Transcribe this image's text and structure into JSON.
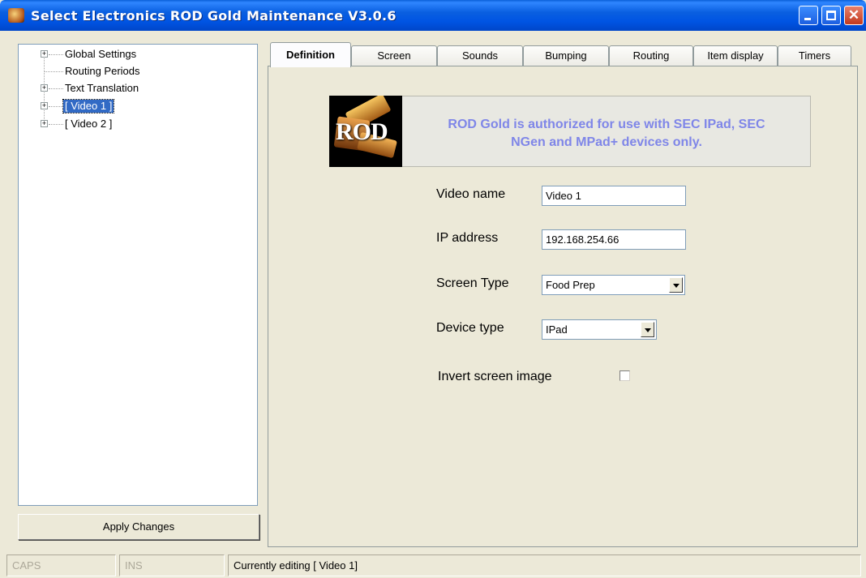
{
  "window": {
    "title": "Select Electronics ROD Gold Maintenance V3.0.6"
  },
  "tree": {
    "items": [
      {
        "label": "Global Settings",
        "expandable": true
      },
      {
        "label": "Routing Periods",
        "expandable": false
      },
      {
        "label": "Text Translation",
        "expandable": true
      },
      {
        "label": "[ Video 1 ]",
        "expandable": true,
        "selected": true
      },
      {
        "label": "[ Video 2 ]",
        "expandable": true
      }
    ],
    "expander_glyph": "+"
  },
  "apply_button": {
    "label": "Apply Changes"
  },
  "tabs": [
    {
      "label": "Definition",
      "active": true
    },
    {
      "label": "Screen"
    },
    {
      "label": "Sounds"
    },
    {
      "label": "Bumping"
    },
    {
      "label": "Routing"
    },
    {
      "label": "Item display"
    },
    {
      "label": "Timers"
    }
  ],
  "banner": {
    "logo_text": "ROD",
    "line1": "ROD Gold is authorized for use with SEC IPad, SEC",
    "line2": "NGen and MPad+ devices only.",
    "text_color": "#7f86e8"
  },
  "form": {
    "video_name": {
      "label": "Video name",
      "value": "Video 1"
    },
    "ip_address": {
      "label": "IP address",
      "value": "192.168.254.66"
    },
    "screen_type": {
      "label": "Screen Type",
      "value": "Food Prep"
    },
    "device_type": {
      "label": "Device type",
      "value": "IPad"
    },
    "invert_screen": {
      "label": "Invert screen image",
      "checked": false
    }
  },
  "statusbar": {
    "caps": "CAPS",
    "ins": "INS",
    "message": "Currently editing [ Video 1]"
  },
  "colors": {
    "titlebar": "#0054e3",
    "selection": "#316ac5",
    "window_bg": "#ece9d8"
  }
}
